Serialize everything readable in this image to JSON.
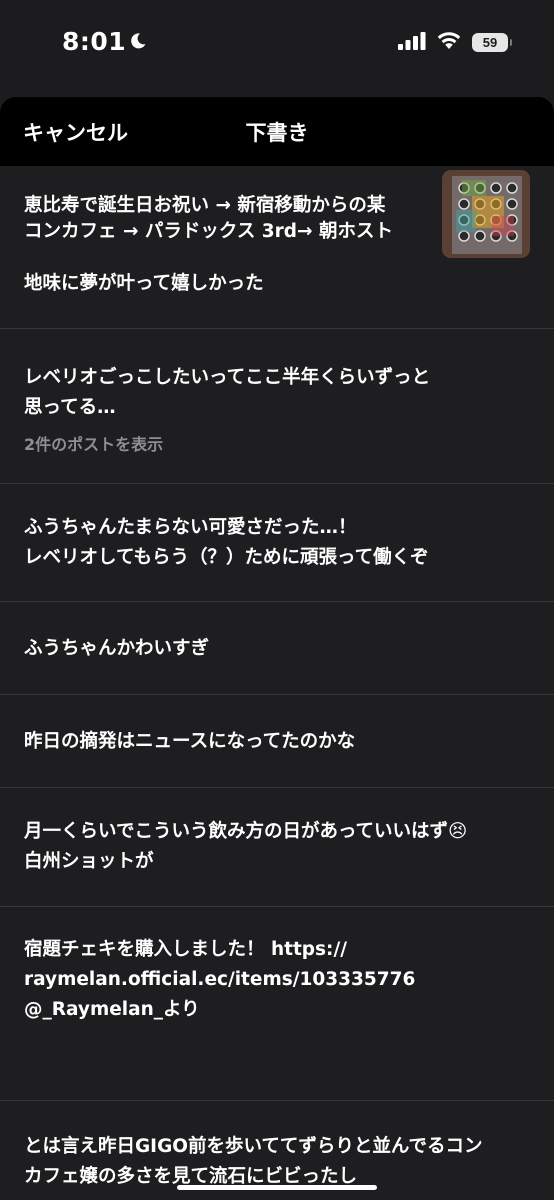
{
  "status": {
    "time": "8:01",
    "battery": "59"
  },
  "header": {
    "cancel_label": "キャンセル",
    "title": "下書き"
  },
  "drafts": [
    {
      "text": "恵比寿で誕生日お祝い → 新宿移動からの某\nコンカフェ → パラドックス 3rd→ 朝ホスト\n\n地味に夢が叶って嬉しかった",
      "has_image": true
    },
    {
      "text": "レベリオごっこしたいってここ半年くらいずっと\n思ってる…",
      "sub": "2件のポストを表示"
    },
    {
      "text": "ふうちゃんたまらない可愛さだった…！\nレベリオしてもらう（？）ために頑張って働くぞ"
    },
    {
      "text": "ふうちゃんかわいすぎ"
    },
    {
      "text": "昨日の摘発はニュースになってたのかな"
    },
    {
      "text": "月一くらいでこういう飲み方の日があっていいはず😣\n白州ショットが"
    },
    {
      "text": "宿題チェキを購入しました！ https://\nraymelan.official.ec/items/103335776\n@_Raymelan_より"
    },
    {
      "text": "とは言え昨日GIGO前を歩いててずらりと並んでるコン\nカフェ嬢の多さを見て流石にビビったし"
    }
  ],
  "icons": {
    "moon": "moon-icon",
    "signal": "cellular-signal-icon",
    "wifi": "wifi-icon",
    "battery": "battery-icon"
  }
}
